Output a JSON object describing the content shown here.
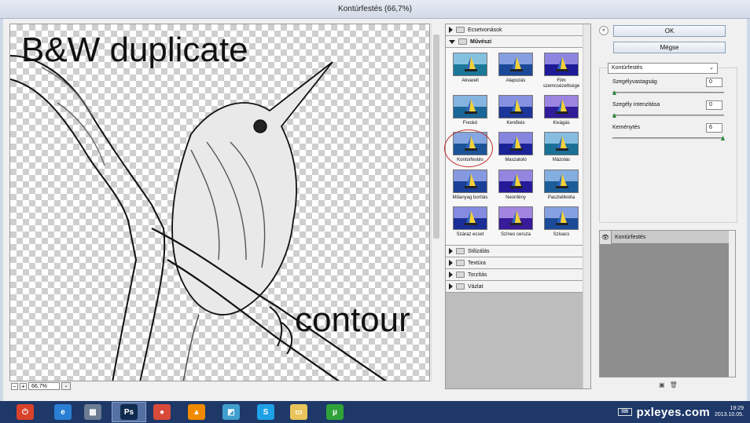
{
  "window": {
    "title": "Kontúrfestés (66,7%)"
  },
  "preview": {
    "overlay_top": "B&W duplicate",
    "overlay_bottom": "contour",
    "zoom_value": "66,7%",
    "zoom_minus": "−",
    "zoom_plus": "+",
    "zoom_drop": "⌄"
  },
  "gallery": {
    "folders_top": [
      {
        "label": "Ecsetvonások"
      }
    ],
    "open_folder": "Művészi",
    "filters": [
      {
        "label": "Akvarell"
      },
      {
        "label": "Alapozás"
      },
      {
        "label": "Film szemcsézettsége"
      },
      {
        "label": "Freskó"
      },
      {
        "label": "Kenőkés"
      },
      {
        "label": "Kivágás"
      },
      {
        "label": "Kontúrfestés"
      },
      {
        "label": "Maszatoló"
      },
      {
        "label": "Mázolás"
      },
      {
        "label": "Műanyag borítás"
      },
      {
        "label": "Neonfény"
      },
      {
        "label": "Pasztellkréta"
      },
      {
        "label": "Száraz ecset"
      },
      {
        "label": "Színes ceruza"
      },
      {
        "label": "Szivacs"
      }
    ],
    "selected_filter": "Kontúrfestés",
    "folders_bottom": [
      {
        "label": "Stilizálás"
      },
      {
        "label": "Textúra"
      },
      {
        "label": "Torzítás"
      },
      {
        "label": "Vázlat"
      }
    ]
  },
  "buttons": {
    "ok": "OK",
    "cancel": "Mégse",
    "expand": "«"
  },
  "settings": {
    "filter_select": "Kontúrfestés",
    "select_arrow": "⌄",
    "params": [
      {
        "label": "Szegélyvastagság",
        "value": "0",
        "fraction": 0.0
      },
      {
        "label": "Szegély intenzitása",
        "value": "0",
        "fraction": 0.0
      },
      {
        "label": "Keménytés",
        "value": "6",
        "fraction": 1.0
      }
    ]
  },
  "layers": {
    "items": [
      {
        "label": "Kontúrfestés"
      }
    ],
    "eye": "👁",
    "new_icon": "▣",
    "delete_icon": "🗑"
  },
  "taskbar": {
    "apps": [
      {
        "name": "power",
        "glyph": "⏻",
        "color": "#d9412b"
      },
      {
        "name": "internet-explorer",
        "glyph": "e",
        "color": "#2a7fd4"
      },
      {
        "name": "calculator",
        "glyph": "▦",
        "color": "#6b7c93"
      },
      {
        "name": "photoshop",
        "glyph": "Ps",
        "color": "#0e2a4d"
      },
      {
        "name": "chrome",
        "glyph": "●",
        "color": "#d94a3a"
      },
      {
        "name": "vlc",
        "glyph": "▲",
        "color": "#f08a00"
      },
      {
        "name": "notes",
        "glyph": "◩",
        "color": "#3f9fcf"
      },
      {
        "name": "skype",
        "glyph": "S",
        "color": "#1ea0e6"
      },
      {
        "name": "explorer",
        "glyph": "▭",
        "color": "#e8c45a"
      },
      {
        "name": "utorrent",
        "glyph": "µ",
        "color": "#2fa23a"
      }
    ],
    "active_app": "photoshop",
    "keyboard": "⌨",
    "watermark": "pxleyes.com",
    "time": "19:29",
    "date": "2013.10.05."
  }
}
